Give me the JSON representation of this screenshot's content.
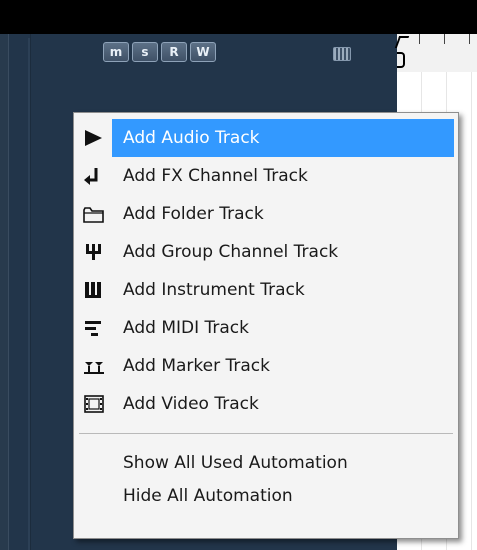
{
  "track_header": {
    "buttons": [
      {
        "label": "m",
        "name": "mute-all-button"
      },
      {
        "label": "s",
        "name": "solo-all-button"
      },
      {
        "label": "R",
        "name": "read-all-button"
      },
      {
        "label": "W",
        "name": "write-all-button"
      }
    ]
  },
  "context_menu": {
    "items": [
      {
        "label": "Add Audio Track",
        "icon": "audio-track-icon",
        "highlighted": true
      },
      {
        "label": "Add FX Channel Track",
        "icon": "fx-channel-icon"
      },
      {
        "label": "Add Folder Track",
        "icon": "folder-icon"
      },
      {
        "label": "Add Group Channel Track",
        "icon": "group-channel-icon"
      },
      {
        "label": "Add Instrument Track",
        "icon": "instrument-icon"
      },
      {
        "label": "Add MIDI Track",
        "icon": "midi-icon"
      },
      {
        "label": "Add Marker Track",
        "icon": "marker-icon"
      },
      {
        "label": "Add Video Track",
        "icon": "video-icon"
      }
    ],
    "automation_items": [
      {
        "label": "Show All Used Automation"
      },
      {
        "label": "Hide All Automation"
      }
    ],
    "highlight_color": "#3399ff"
  }
}
